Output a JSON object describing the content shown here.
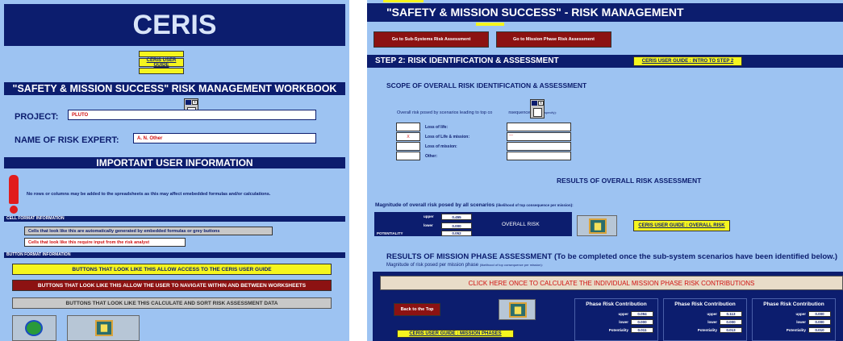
{
  "left": {
    "title": "CERIS",
    "user_guide_btn": "CERIS USER GUIDE",
    "workbook_title": "\"SAFETY & MISSION SUCCESS\" RISK MANAGEMENT WORKBOOK",
    "project_label": "PROJECT:",
    "project_value": "PLUTO",
    "expert_label": "NAME OF RISK EXPERT:",
    "expert_value": "A. N. Other",
    "important_heading": "IMPORTANT USER INFORMATION",
    "warning_text": "No rows or columns may be added to the spreadsheets as this may affect emebedded formulas and/or calculations.",
    "cell_format_heading": "CELL FORMAT INFORMATION",
    "cell_auto_text": "Cells that look like this are automatically generated by embedded formulas or grey buttons",
    "cell_input_text": "Cells that look like this require input from the risk analyst",
    "button_format_heading": "BUTTON FORMAT INFORMATION",
    "btn_yellow_text": "BUTTONS THAT LOOK LIKE THIS ALLOW ACCESS TO THE CERIS USER GUIDE",
    "btn_red_text": "BUTTONS THAT LOOK LIKE THIS ALLOW THE USER TO NAVIGATE WITHIN AND BETWEEN WORKSHEETS",
    "btn_grey_text": "BUTTONS THAT LOOK LIKE THIS CALCULATE AND SORT RISK ASSESSMENT DATA"
  },
  "right": {
    "title": "\"SAFETY & MISSION SUCCESS\" - RISK MANAGEMENT",
    "nav_subsystems": "Go to Sub-Systems Risk Assessment",
    "nav_mission_phase": "Go to Mission Phase Risk Assessment",
    "step_heading": "STEP 2: RISK IDENTIFICATION & ASSESSMENT",
    "guide_step2": "CERIS USER GUIDE : INTRO TO STEP 2",
    "scope_heading": "SCOPE OF OVERALL RISK IDENTIFICATION & ASSESSMENT",
    "overall_text_a": "Overall risk posed by scenarios leading to top co",
    "overall_text_b": "nsequence",
    "overall_text_c": "(tick and specify):",
    "checklist": [
      {
        "mark": "",
        "label": "Loss of life:"
      },
      {
        "mark": "X",
        "label": "Loss of Life & mission:"
      },
      {
        "mark": "",
        "label": "Loss of mission:"
      },
      {
        "mark": "",
        "label": "Other:"
      }
    ],
    "spec_values": [
      "",
      "---",
      "",
      ""
    ],
    "results_heading": "RESULTS OF OVERALL RISK ASSESSMENT",
    "magnitude_text": "Magnitude of overall risk posed by all scenarios",
    "magnitude_sub": "(likelihood of top consequence per mission):",
    "upper_label": "upper",
    "upper_value": "0.455",
    "lower_label": "lower",
    "lower_value": "0.000",
    "potentiality_label": "POTENTIALITY",
    "potentiality_value": "0.052",
    "overall_risk_label": "OVERALL RISK",
    "guide_overall": "CERIS USER GUIDE : OVERALL RISK",
    "mission_heading": "RESULTS OF MISSION PHASE ASSESSMENT (To be completed once the sub-system scenarios have been identified below.)",
    "mission_sub_a": "Magnitude of risk posed per mission phase",
    "mission_sub_b": "(likelihood of top consequence per mission):",
    "calc_btn": "CLICK HERE ONCE TO CALCULATE THE INDIVIDUAL MISSION PHASE RISK CONTRIBUTIONS",
    "back_to_top": "Back to the Top",
    "guide_mission": "CERIS USER GUIDE : MISSION PHASES",
    "phase_cols": [
      {
        "title": "Phase Risk Contribution",
        "upper": "0.094",
        "lower": "0.000",
        "pot": "0.011"
      },
      {
        "title": "Phase Risk Contribution",
        "upper": "0.113",
        "lower": "0.000",
        "pot": "0.013"
      },
      {
        "title": "Phase Risk Contribution",
        "upper": "0.000",
        "lower": "0.000",
        "pot": "0.010"
      }
    ],
    "row_upper": "upper",
    "row_lower": "lower",
    "row_pot": "Potentiality"
  },
  "colors": {
    "navy": "#0c1d6e",
    "panel_bg": "#9dc3f2",
    "yellow": "#f5f51e",
    "maroon": "#8c1212",
    "grey": "#c8c8c8"
  },
  "icons": [
    "warning-exclamation-icon",
    "globe-tool-icon",
    "chart-icon",
    "mini-toolbar-icon"
  ]
}
